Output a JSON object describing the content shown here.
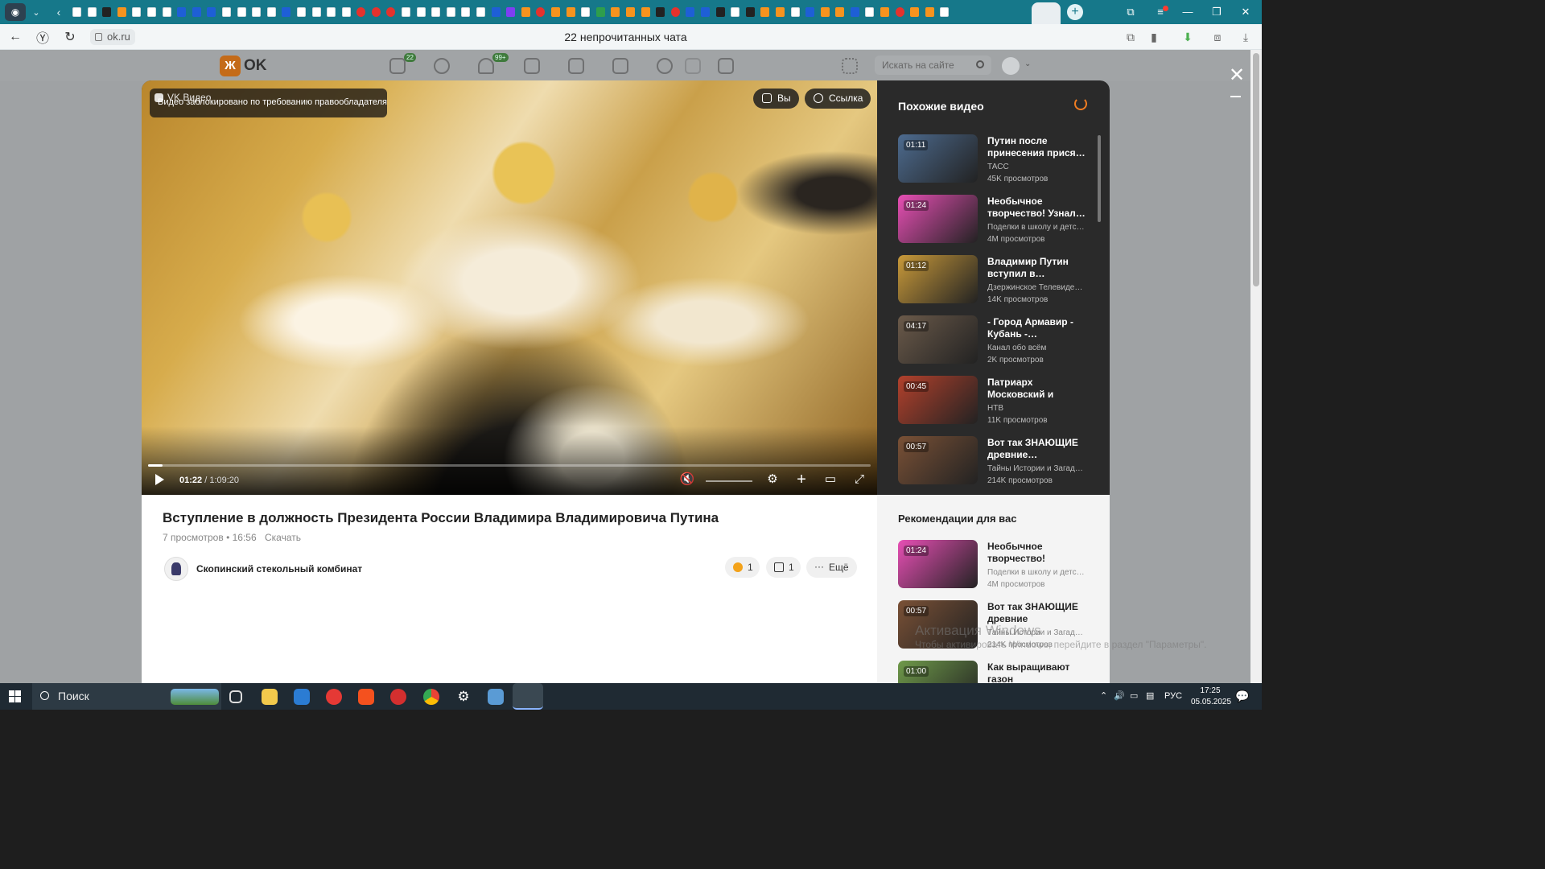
{
  "browser": {
    "page_title": "22 непрочитанных чата",
    "url": "ok.ru"
  },
  "ok_header": {
    "logo_text": "OK",
    "messages_badge": "22",
    "notifications_badge": "99+",
    "search_placeholder": "Искать на сайте"
  },
  "player": {
    "brand": "VK Видео",
    "blocked_message": "Видео заблокировано по требованию правообладателя",
    "like_label": "Вы",
    "link_label": "Ссылка",
    "current_time": "01:22",
    "duration": "1:09:20",
    "progress_fraction": 0.02
  },
  "similar": {
    "title": "Похожие видео",
    "items": [
      {
        "duration": "01:11",
        "title": "Путин после принесения прися…",
        "channel": "ТАСС",
        "views": "45K просмотров",
        "thumb_color": "#4d6b8f"
      },
      {
        "duration": "01:24",
        "title": "Необычное творчество! Узнал…",
        "channel": "Поделки в школу и детс…",
        "views": "4M просмотров",
        "thumb_color": "#e84fb5"
      },
      {
        "duration": "01:12",
        "title": "Владимир Путин вступил в…",
        "channel": "Дзержинское Телевиде…",
        "views": "14K просмотров",
        "thumb_color": "#c99a3a"
      },
      {
        "duration": "04:17",
        "title": "- Город Армавир - Кубань -…",
        "channel": "Канал обо всём",
        "views": "2K просмотров",
        "thumb_color": "#6b5a4a"
      },
      {
        "duration": "00:45",
        "title": "Патриарх Московский и всея…",
        "channel": "НТВ",
        "views": "11K просмотров",
        "thumb_color": "#b3412c"
      },
      {
        "duration": "00:57",
        "title": "Вот так ЗНАЮЩИЕ древние…",
        "channel": "Тайны Истории и Загад…",
        "views": "214K просмотров",
        "thumb_color": "#7a5136"
      }
    ]
  },
  "video_info": {
    "title": "Вступление в должность Президента России Владимира Владимировича Путина",
    "views": "7 просмотров",
    "time": "16:56",
    "download_label": "Скачать",
    "owner": "Скопинский стекольный комбинат",
    "likes": "1",
    "shares": "1",
    "more_label": "Ещё"
  },
  "recommendations": {
    "title": "Рекомендации для вас",
    "items": [
      {
        "duration": "01:24",
        "title": "Необычное творчество! Узнали…",
        "channel": "Поделки в школу и детск…",
        "views": "4M просмотров",
        "thumb_color": "#e84fb5"
      },
      {
        "duration": "00:57",
        "title": "Вот так ЗНАЮЩИЕ древние тестирова…",
        "channel": "Тайны Истории и Загадк…",
        "views": "214K просмотров",
        "thumb_color": "#7a5136"
      },
      {
        "duration": "01:00",
        "title": "Как выращивают газон",
        "channel": "",
        "views": "",
        "thumb_color": "#6f9a4a"
      }
    ]
  },
  "watermark": {
    "line1": "Активация Windows",
    "line2": "Чтобы активировать Windows, перейдите в раздел \"Параметры\"."
  },
  "taskbar": {
    "search_label": "Поиск",
    "lang": "РУС",
    "time": "17:25",
    "date": "05.05.2025"
  }
}
